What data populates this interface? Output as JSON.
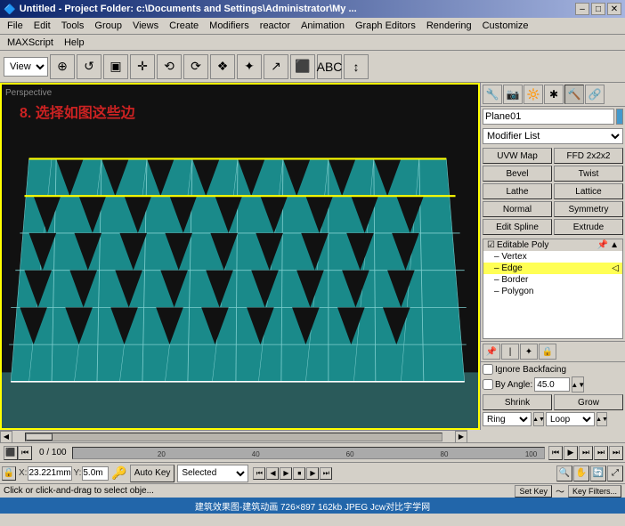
{
  "titlebar": {
    "title": "Untitled  - Project Folder: c:\\Documents and Settings\\Administrator\\My ...",
    "icon": "🔷",
    "min_label": "–",
    "max_label": "□",
    "close_label": "✕"
  },
  "menubar1": {
    "items": [
      "File",
      "Edit",
      "Tools",
      "Group",
      "Views",
      "Create",
      "Modifiers",
      "reactor",
      "Animation",
      "Graph Editors",
      "Rendering",
      "Customize"
    ]
  },
  "menubar2": {
    "items": [
      "MAXScript",
      "Help"
    ]
  },
  "toolbar": {
    "view_label": "View",
    "icons": [
      "⊕",
      "↺",
      "▣",
      "✛",
      "⟲",
      "⟳",
      "❖",
      "✦",
      "↗",
      "⬛",
      "ABC",
      "↕"
    ]
  },
  "viewport": {
    "label": "Perspective",
    "instruction": "8. 选择如图这些边",
    "resolution": "726×897 162kb JPEG"
  },
  "right_panel": {
    "object_name": "Plane01",
    "modifier_list_label": "Modifier List",
    "modifier_buttons": [
      "UVW Map",
      "FFD 2x2x2",
      "Bevel",
      "Twist",
      "Lathe",
      "Lattice",
      "Normal",
      "Symmetry",
      "Edit Spline",
      "Extrude"
    ],
    "stack": {
      "header": "Editable Poly",
      "items": [
        {
          "label": "Vertex",
          "indent": 1,
          "selected": false
        },
        {
          "label": "Edge",
          "indent": 1,
          "selected": true
        },
        {
          "label": "Border",
          "indent": 1,
          "selected": false
        },
        {
          "label": "Polygon",
          "indent": 1,
          "selected": false
        }
      ]
    },
    "properties": {
      "ignore_backfacing_label": "Ignore Backfacing",
      "by_angle_label": "By Angle:",
      "by_angle_value": "45.0",
      "shrink_label": "Shrink",
      "grow_label": "Grow",
      "ring_label": "Ring",
      "loop_label": "Loop"
    }
  },
  "timeline": {
    "frame_display": "0 / 100",
    "tick_labels": [
      "20",
      "40",
      "60",
      "80",
      "100"
    ]
  },
  "bottom_controls": {
    "coord_x": "23.221mm",
    "coord_x_label": "X:",
    "coord_y": "5.0m",
    "coord_y_label": "Y:",
    "autokey_label": "Auto Key",
    "selected_label": "Selected",
    "setkey_label": "Set Key",
    "keyfilters_label": "Key Filters...",
    "nav_buttons": [
      "⏮",
      "⏭",
      "▶",
      "⏹",
      "⏭",
      "⏭",
      "⏭"
    ]
  },
  "status_bar": {
    "text": "Click or click-and-drag to select obje..."
  },
  "watermark": {
    "text": "建筑效果图-建筑动画      726×897 162kb JPEG      Jcw对比字学网"
  }
}
